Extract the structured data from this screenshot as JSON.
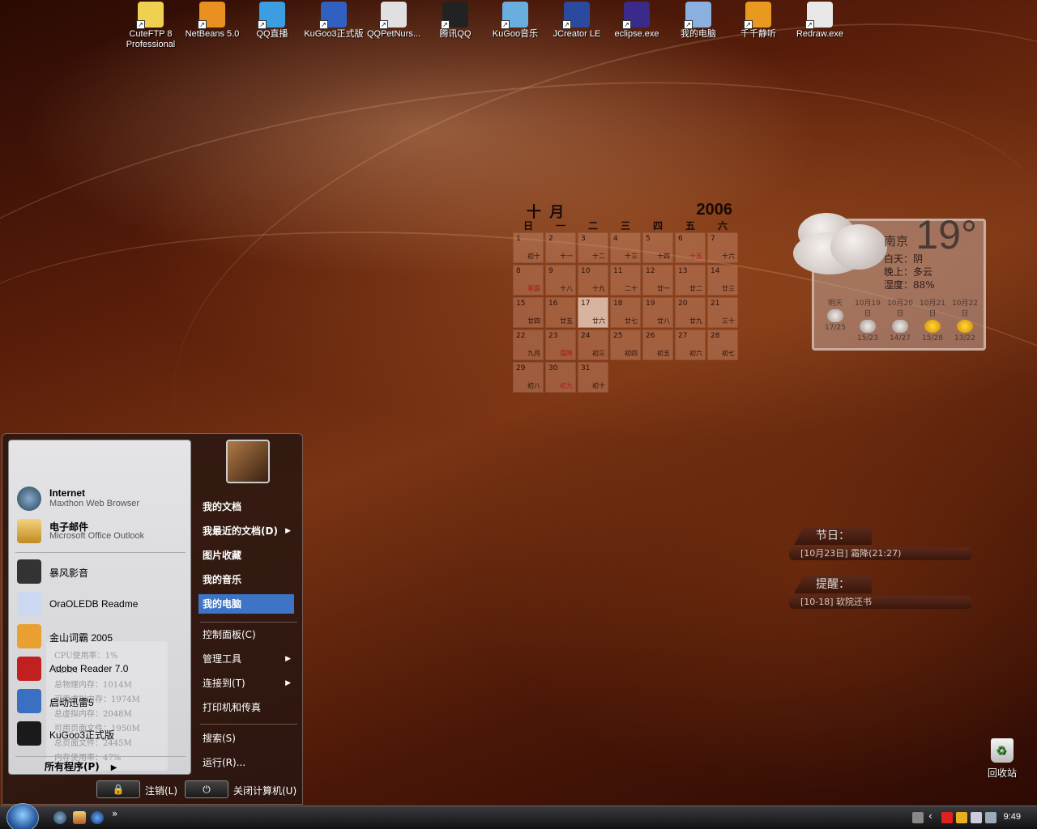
{
  "desktop_icons": [
    {
      "label": "CuteFTP 8\nProfessional",
      "icon": "cuteftp-icon"
    },
    {
      "label": "NetBeans 5.0",
      "icon": "netbeans-icon"
    },
    {
      "label": "QQ直播",
      "icon": "qq-live-icon"
    },
    {
      "label": "KuGoo3正式版",
      "icon": "kugoo3-icon"
    },
    {
      "label": "QQPetNurs...",
      "icon": "qqpet-icon"
    },
    {
      "label": "腾讯QQ",
      "icon": "qq-penguin-icon"
    },
    {
      "label": "KuGoo音乐",
      "icon": "kugoo-music-icon"
    },
    {
      "label": "JCreator LE",
      "icon": "jcreator-icon"
    },
    {
      "label": "eclipse.exe",
      "icon": "eclipse-icon"
    },
    {
      "label": "我的电脑",
      "icon": "my-computer-icon"
    },
    {
      "label": "千千静听",
      "icon": "ttplayer-icon"
    },
    {
      "label": "Redraw.exe",
      "icon": "redraw-icon"
    }
  ],
  "calendar": {
    "month": "十 月",
    "year": "2006",
    "weekdays": [
      "日",
      "一",
      "二",
      "三",
      "四",
      "五",
      "六"
    ],
    "today": "17",
    "days": [
      {
        "d": "1",
        "l": "初十",
        "red": false
      },
      {
        "d": "2",
        "l": "十一",
        "red": false
      },
      {
        "d": "3",
        "l": "十二",
        "red": false
      },
      {
        "d": "4",
        "l": "十三",
        "red": false
      },
      {
        "d": "5",
        "l": "十四",
        "red": false
      },
      {
        "d": "6",
        "l": "十五",
        "red": true
      },
      {
        "d": "7",
        "l": "十六",
        "red": false
      },
      {
        "d": "8",
        "l": "寒露",
        "red": true
      },
      {
        "d": "9",
        "l": "十八",
        "red": false
      },
      {
        "d": "10",
        "l": "十九",
        "red": false
      },
      {
        "d": "11",
        "l": "二十",
        "red": false
      },
      {
        "d": "12",
        "l": "廿一",
        "red": false
      },
      {
        "d": "13",
        "l": "廿二",
        "red": false
      },
      {
        "d": "14",
        "l": "廿三",
        "red": false
      },
      {
        "d": "15",
        "l": "廿四",
        "red": false
      },
      {
        "d": "16",
        "l": "廿五",
        "red": false
      },
      {
        "d": "17",
        "l": "廿六",
        "red": false
      },
      {
        "d": "18",
        "l": "廿七",
        "red": false
      },
      {
        "d": "19",
        "l": "廿八",
        "red": false
      },
      {
        "d": "20",
        "l": "廿九",
        "red": false
      },
      {
        "d": "21",
        "l": "三十",
        "red": false
      },
      {
        "d": "22",
        "l": "九月",
        "red": false
      },
      {
        "d": "23",
        "l": "霜降",
        "red": true
      },
      {
        "d": "24",
        "l": "初三",
        "red": false
      },
      {
        "d": "25",
        "l": "初四",
        "red": false
      },
      {
        "d": "26",
        "l": "初五",
        "red": false
      },
      {
        "d": "27",
        "l": "初六",
        "red": false
      },
      {
        "d": "28",
        "l": "初七",
        "red": false
      },
      {
        "d": "29",
        "l": "初八",
        "red": false
      },
      {
        "d": "30",
        "l": "初九",
        "red": true
      },
      {
        "d": "31",
        "l": "初十",
        "red": false
      }
    ]
  },
  "weather": {
    "temp": "19°",
    "city": "南京",
    "day": "白天：阴",
    "night": "晚上：多云",
    "humidity": "湿度：88%",
    "forecast": [
      {
        "date": "明天",
        "range": "17/25",
        "icon": "cloud"
      },
      {
        "date": "10月19日",
        "range": "15/23",
        "icon": "rain"
      },
      {
        "date": "10月20日",
        "range": "14/27",
        "icon": "rain"
      },
      {
        "date": "10月21日",
        "range": "15/28",
        "icon": "sun"
      },
      {
        "date": "10月22日",
        "range": "13/22",
        "icon": "sun"
      }
    ]
  },
  "holiday": {
    "title": "节日：",
    "text": "[10月23日] 霜降(21:27)"
  },
  "reminder": {
    "title": "提醒：",
    "text": "[10-18] 软院还书"
  },
  "recycle_bin": {
    "label": "回收站"
  },
  "start_menu": {
    "pinned": [
      {
        "title": "Internet",
        "sub": "Maxthon Web Browser"
      },
      {
        "title": "电子邮件",
        "sub": "Microsoft Office Outlook"
      }
    ],
    "recent": [
      "暴风影音",
      "OraOLEDB Readme",
      "金山词霸 2005",
      "Adobe Reader 7.0",
      "启动迅雷5",
      "KuGoo3正式版"
    ],
    "sysmon": [
      "CPU使用率：1%",
      "529M",
      "总物理内存：1014M",
      "可用虚拟内存：1974M",
      "总虚拟内存：2048M",
      "可用页面文件：1950M",
      "总页面文件：2445M",
      "内存使用率：47%"
    ],
    "all_programs": "所有程序(P)",
    "right_items": [
      {
        "label": "我的文档",
        "bold": true,
        "arrow": false
      },
      {
        "label": "我最近的文档(D)",
        "bold": true,
        "arrow": true
      },
      {
        "label": "图片收藏",
        "bold": true,
        "arrow": false
      },
      {
        "label": "我的音乐",
        "bold": true,
        "arrow": false
      },
      {
        "label": "我的电脑",
        "bold": true,
        "arrow": false,
        "selected": true
      },
      {
        "label": "控制面板(C)",
        "bold": false,
        "arrow": false
      },
      {
        "label": "管理工具",
        "bold": false,
        "arrow": true
      },
      {
        "label": "连接到(T)",
        "bold": false,
        "arrow": true
      },
      {
        "label": "打印机和传真",
        "bold": false,
        "arrow": false
      },
      {
        "label": "搜索(S)",
        "bold": false,
        "arrow": false
      },
      {
        "label": "运行(R)...",
        "bold": false,
        "arrow": false
      }
    ],
    "logoff": "注销(L)",
    "shutdown": "关闭计算机(U)"
  },
  "taskbar": {
    "time": "9:49",
    "quicklaunch_more": "»"
  }
}
